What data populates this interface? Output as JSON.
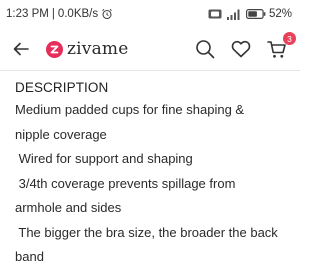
{
  "status_bar": {
    "time": "1:23 PM",
    "separator": "|",
    "network_speed": "0.0KB/s",
    "alarm_icon": "alarm-clock-icon",
    "battery_percent": "52%"
  },
  "header": {
    "back_icon": "arrow-left-icon",
    "logo_text": "zivame",
    "search_icon": "search-icon",
    "wishlist_icon": "heart-icon",
    "cart_icon": "cart-icon",
    "cart_count": "3",
    "brand_color": "#e52e5a"
  },
  "description": {
    "heading": "DESCRIPTION",
    "lines": [
      "Medium padded cups for fine shaping &",
      "nipple coverage",
      " Wired for support and shaping",
      " 3/4th coverage prevents spillage from",
      "armhole and sides",
      " The bigger the bra size, the broader the back",
      "band"
    ]
  }
}
